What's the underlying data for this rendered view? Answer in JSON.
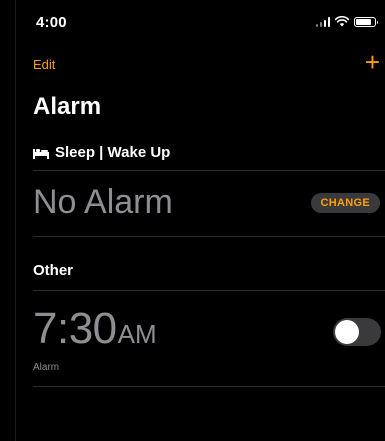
{
  "status_bar": {
    "time": "4:00"
  },
  "nav": {
    "edit_label": "Edit",
    "add_label": "+"
  },
  "page": {
    "title": "Alarm"
  },
  "sleep_section": {
    "header": "Sleep | Wake Up",
    "status_text": "No Alarm",
    "change_label": "CHANGE"
  },
  "other_section": {
    "header": "Other",
    "alarms": [
      {
        "time": "7:30",
        "period": "AM",
        "label": "Alarm",
        "enabled": false
      }
    ]
  },
  "colors": {
    "accent": "#ff9f0a",
    "background": "#000000",
    "secondary_text": "#8e8e93"
  }
}
